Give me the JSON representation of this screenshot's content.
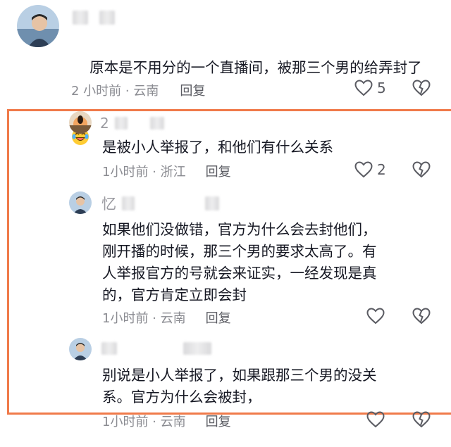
{
  "comments": [
    {
      "name": "",
      "body": "原本是不用分的一个直播间，被那三个男的给弄封了",
      "time_location": "2 小时前 · 云南",
      "reply_label": "回复",
      "like_count": "5"
    },
    {
      "name": "2",
      "body": "是被小人举报了，和他们有什么关系",
      "time_location": "1小时前 · 浙江",
      "reply_label": "回复",
      "like_count": "2"
    },
    {
      "name": "忆",
      "body": "如果他们没做错，官方为什么会去封他们，\n刚开播的时候，那三个男的要求太高了。有\n人举报官方的号就会来证实，一经发现是真\n的，官方肯定立即会封",
      "time_location": "1小时前 · 云南",
      "reply_label": "回复",
      "like_count": ""
    },
    {
      "name": "",
      "body": "别说是小人举报了，如果跟那三个男的没关\n系。官方为什么会被封，",
      "time_location": "1小时前 · 云南",
      "reply_label": "回复",
      "like_count": ""
    }
  ],
  "icons": {
    "like": "heart-outline-icon",
    "dislike": "broken-heart-icon",
    "emoji": "laughing-tears-emoji"
  },
  "colors": {
    "highlight": "#f07a4a",
    "text": "#161823",
    "muted": "#8a8b91"
  }
}
